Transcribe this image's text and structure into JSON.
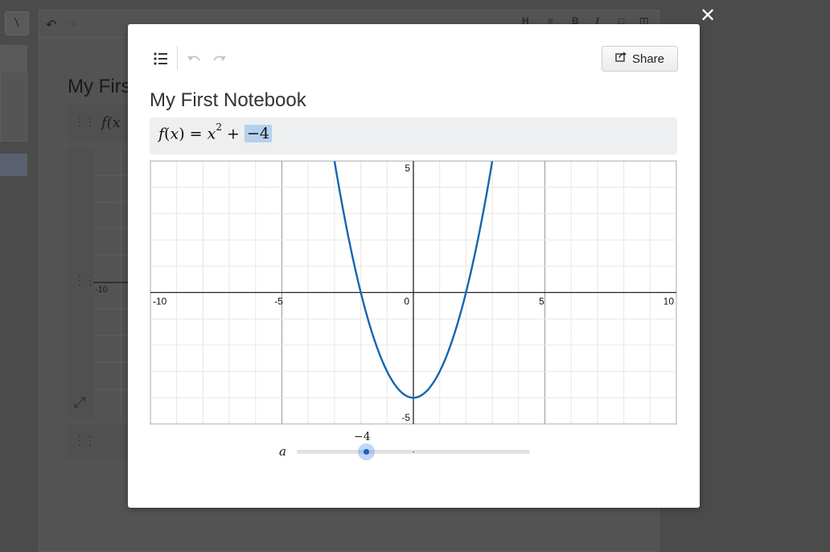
{
  "background": {
    "toolbar_button": "\\",
    "title": "My Firs",
    "expression": "f(x",
    "axis_tick": "-10"
  },
  "modal": {
    "close_icon": "close-icon",
    "toolbar": {
      "list_icon": "list-icon",
      "undo_icon": "undo-icon",
      "redo_icon": "redo-icon"
    },
    "share_label": "Share",
    "notebook_title": "My First Notebook",
    "expression": {
      "fn": "f",
      "var": "x",
      "op": "=",
      "base": "x",
      "exponent": "2",
      "plus": "+",
      "param_value": "−4"
    },
    "slider": {
      "name": "a",
      "value_label": "−4",
      "min": -10,
      "max": 10,
      "value": -4
    }
  },
  "chart_data": {
    "type": "line",
    "series": [
      {
        "expression": "x^2 - 4",
        "color": "#1565b0"
      }
    ],
    "xlim": [
      -10,
      10
    ],
    "ylim": [
      -5,
      5
    ],
    "x_ticks": [
      "-10",
      "-5",
      "0",
      "5",
      "10"
    ],
    "y_ticks": [
      "5",
      "-5"
    ],
    "grid": true,
    "accent_color": "#1565b0"
  }
}
